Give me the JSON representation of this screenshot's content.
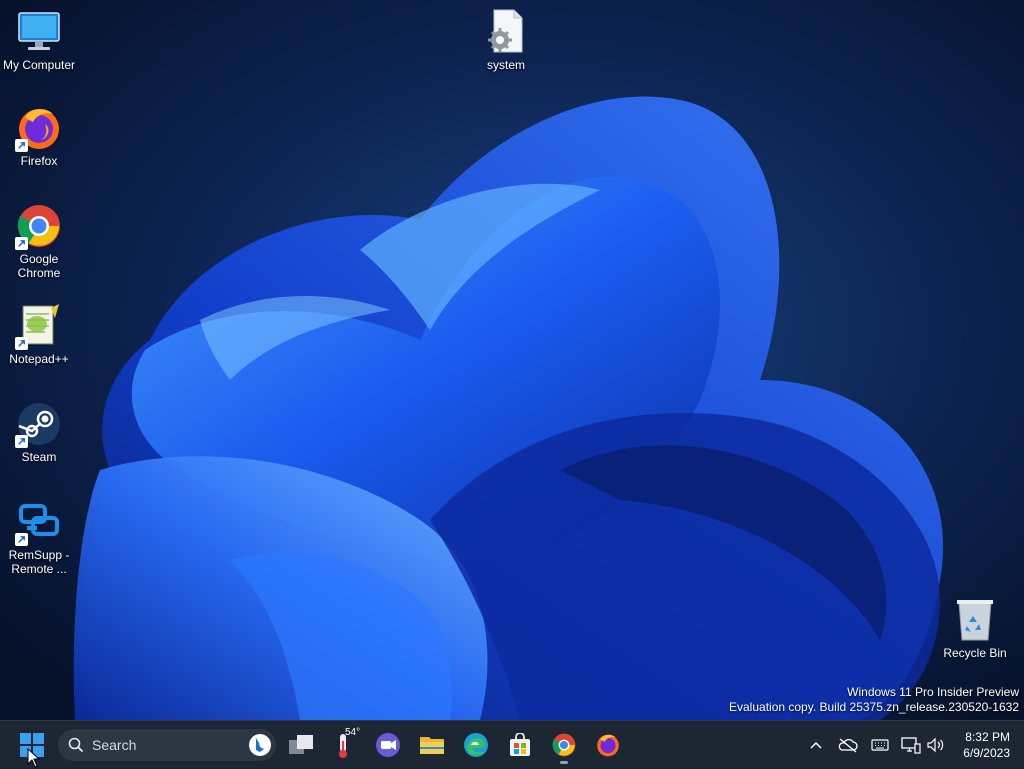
{
  "desktop": {
    "icons": [
      {
        "label": "My Computer"
      },
      {
        "label": "Firefox"
      },
      {
        "label": "Google Chrome"
      },
      {
        "label": "Notepad++"
      },
      {
        "label": "Steam"
      },
      {
        "label": "RemSupp - Remote ..."
      },
      {
        "label": "system"
      },
      {
        "label": "Recycle Bin"
      }
    ]
  },
  "watermark": {
    "line1": "Windows 11 Pro Insider Preview",
    "line2": "Evaluation copy. Build 25375.zn_release.230520-1632"
  },
  "taskbar": {
    "search_placeholder": "Search",
    "weather_temp": "54°",
    "pinned": [
      "task-view",
      "weather",
      "teams-chat",
      "file-explorer",
      "edge",
      "microsoft-store",
      "chrome",
      "firefox"
    ],
    "clock": {
      "time": "8:32 PM",
      "date": "6/9/2023"
    }
  },
  "colors": {
    "taskbar_bg": "#1d2633",
    "accent": "#1f7fe0",
    "wallpaper_bg": "#0a1733"
  }
}
